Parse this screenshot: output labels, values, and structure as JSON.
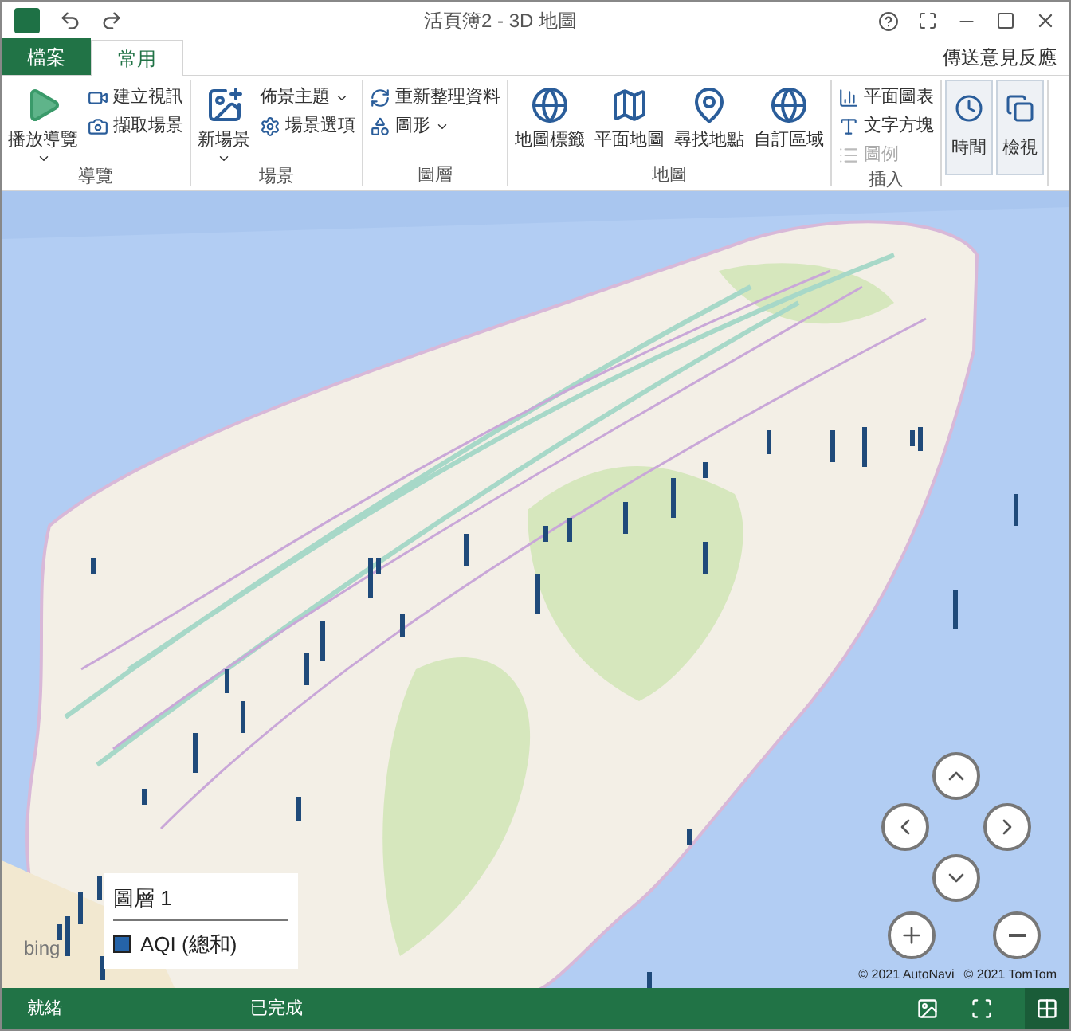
{
  "window": {
    "title": "活頁簿2 - 3D 地圖"
  },
  "tabs": [
    {
      "label": "檔案",
      "kind": "file",
      "selected": false
    },
    {
      "label": "常用",
      "kind": "tab",
      "selected": true
    }
  ],
  "feedback": "傳送意見反應",
  "ribbon": [
    {
      "label": "導覽",
      "items": [
        {
          "kind": "large",
          "label": "播放導覽",
          "dropdown": true
        },
        {
          "kind": "small",
          "label": "建立視訊",
          "disabled": false
        },
        {
          "kind": "small",
          "label": "擷取場景",
          "disabled": false
        }
      ]
    },
    {
      "label": "場景",
      "items": [
        {
          "kind": "large",
          "label": "新場景",
          "dropdown": true
        },
        {
          "kind": "small",
          "label": "佈景主題",
          "dropdown": true,
          "disabled": false
        },
        {
          "kind": "small",
          "label": "場景選項",
          "disabled": false
        }
      ]
    },
    {
      "label": "圖層",
      "items": [
        {
          "kind": "small",
          "label": "重新整理資料",
          "disabled": false
        },
        {
          "kind": "small",
          "label": "圖形",
          "dropdown": true,
          "disabled": false
        }
      ]
    },
    {
      "label": "地圖",
      "items": [
        {
          "kind": "large",
          "label": "地圖標籤"
        },
        {
          "kind": "large",
          "label": "平面地圖"
        },
        {
          "kind": "large",
          "label": "尋找地點"
        },
        {
          "kind": "large",
          "label": "自訂區域"
        }
      ]
    },
    {
      "label": "插入",
      "items": [
        {
          "kind": "small",
          "label": "平面圖表",
          "disabled": false
        },
        {
          "kind": "small",
          "label": "文字方塊",
          "disabled": false
        },
        {
          "kind": "small",
          "label": "圖例",
          "disabled": true
        }
      ]
    },
    {
      "items": [
        {
          "kind": "panel",
          "label": "時間"
        },
        {
          "kind": "panel",
          "label": "檢視"
        }
      ]
    }
  ],
  "legend": {
    "title": "圖層 1",
    "entries": [
      {
        "label": "AQI (總和)",
        "color": "#2563a8"
      }
    ]
  },
  "attribution": [
    "© 2021 AutoNavi",
    "© 2021 TomTom"
  ],
  "bing_logo": "bing",
  "status_bar": {
    "left": "就緒",
    "middle": "已完成"
  }
}
